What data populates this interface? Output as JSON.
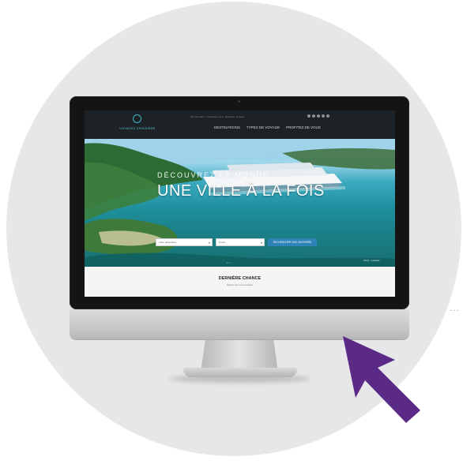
{
  "colors": {
    "circle_background": "#e7e7e9",
    "cursor_arrow": "#5b2a86",
    "site_header": "#1d2227",
    "search_button": "#2d83b8",
    "logo_accent": "#3fb4c8"
  },
  "site": {
    "logo_text": "VOYAGEZ CROISIÈRE",
    "topbar_text": "Service client · Contactez-nous · Réservez en ligne",
    "nav": [
      "DESTINATIONS",
      "TYPES DE VOYAGE",
      "PROFITEZ DE VOUS"
    ],
    "hero": {
      "subtitle": "DÉCOUVREZ LE MONDE",
      "title": "UNE VILLE À LA FOIS",
      "search": {
        "destination_placeholder": "Votre destination",
        "duration_placeholder": "Durée",
        "button_label": "RECHERCHER UNE CROISIÈRE"
      },
      "credit": "Photo : Labadee",
      "dots": "● ○ ○"
    },
    "section": {
      "title": "DERNIÈRE CHANCE",
      "subtitle": "Réglez à bord avantages"
    }
  },
  "icons": {
    "cursor": "arrow-cursor-icon",
    "logo": "logo-icon"
  },
  "decor": {
    "ellipsis": "···"
  }
}
